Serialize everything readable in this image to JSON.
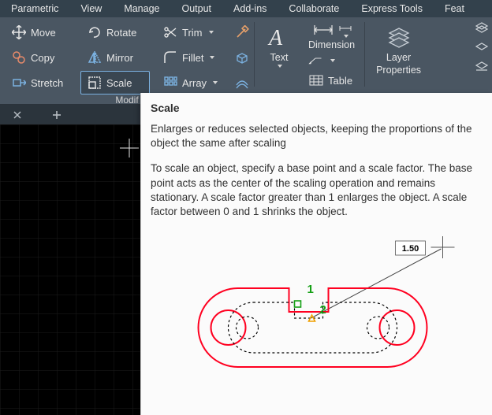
{
  "menu": {
    "items": [
      "Parametric",
      "View",
      "Manage",
      "Output",
      "Add-ins",
      "Collaborate",
      "Express Tools",
      "Feat"
    ]
  },
  "modify_panel": {
    "label": "Modif",
    "move": "Move",
    "copy": "Copy",
    "stretch": "Stretch",
    "rotate": "Rotate",
    "mirror": "Mirror",
    "scale": "Scale",
    "trim": "Trim",
    "fillet": "Fillet",
    "array": "Array"
  },
  "annotation_panel": {
    "text": "Text",
    "dimension": "Dimension",
    "table": "Table"
  },
  "layers_panel": {
    "layer_properties_l1": "Layer",
    "layer_properties_l2": "Properties"
  },
  "tooltip": {
    "title": "Scale",
    "summary": "Enlarges or reduces selected objects, keeping the proportions of the object the same after scaling",
    "detail": "To scale an object, specify a base point and a scale factor. The base point acts as the center of the scaling operation and remains stationary. A scale factor greater than 1 enlarges the object. A scale factor between 0 and 1 shrinks the object.",
    "marker1": "1",
    "marker2": "2",
    "scale_value": "1.50"
  }
}
